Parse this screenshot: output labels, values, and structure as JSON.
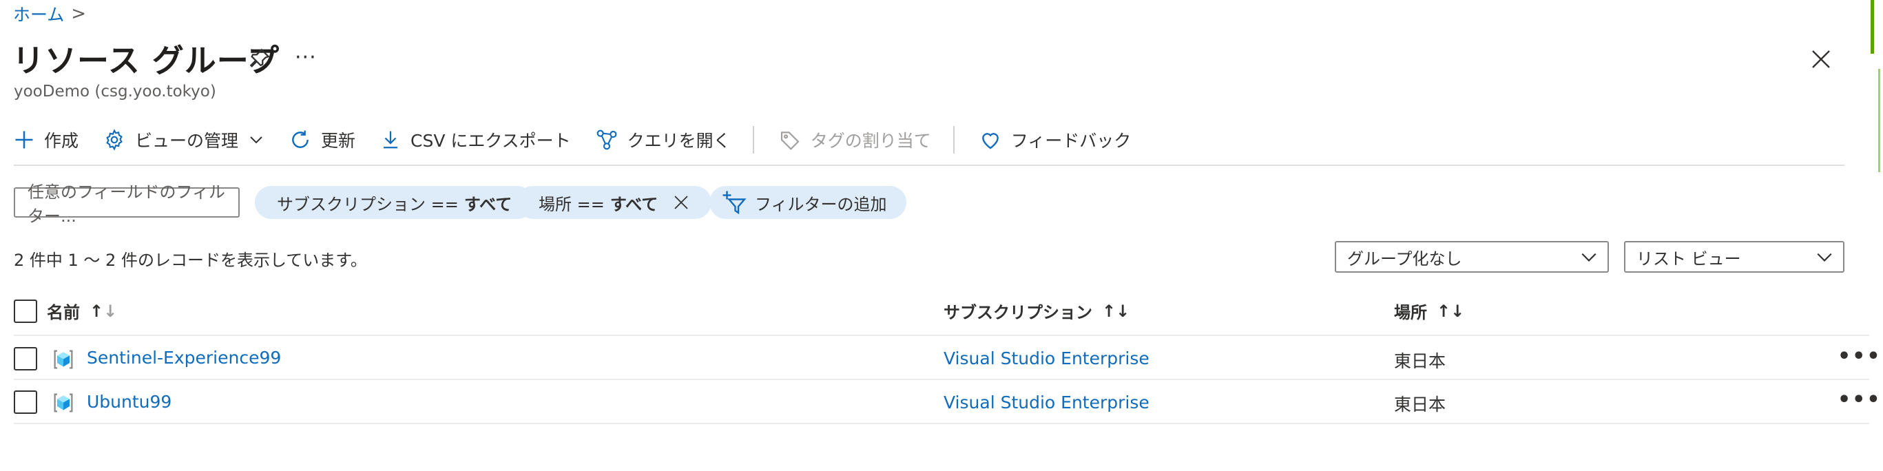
{
  "breadcrumb": {
    "home": "ホーム",
    "separator": ">"
  },
  "header": {
    "title": "リソース グループ",
    "subtitle": "yooDemo (csg.yoo.tokyo)",
    "more": "···",
    "pin_icon": "pin-icon",
    "close_icon": "close-icon"
  },
  "toolbar": {
    "create": "作成",
    "manage_view": "ビューの管理",
    "refresh": "更新",
    "export_csv": "CSV にエクスポート",
    "open_query": "クエリを開く",
    "assign_tags": "タグの割り当て",
    "feedback": "フィードバック"
  },
  "filters": {
    "search_placeholder": "任意のフィールドのフィルター...",
    "subscription": {
      "label": "サブスクリプション ==",
      "value": "すべて"
    },
    "location": {
      "label": "場所 ==",
      "value": "すべて"
    },
    "add_filter": "フィルターの追加"
  },
  "summary": "2 件中 1 ～ 2 件のレコードを表示しています。",
  "grouping": {
    "selected": "グループ化なし"
  },
  "view": {
    "selected": "リスト ビュー"
  },
  "table": {
    "columns": [
      "名前",
      "サブスクリプション",
      "場所"
    ],
    "sort_up": "↑",
    "sort_down": "↓",
    "rows": [
      {
        "name": "Sentinel-Experience99",
        "subscription": "Visual Studio Enterprise",
        "location": "東日本",
        "more": "•••"
      },
      {
        "name": "Ubuntu99",
        "subscription": "Visual Studio Enterprise",
        "location": "東日本",
        "more": "•••"
      }
    ]
  },
  "colors": {
    "link": "#0f6cbd",
    "pill_bg": "#deecf9",
    "accent": "#57a300"
  }
}
